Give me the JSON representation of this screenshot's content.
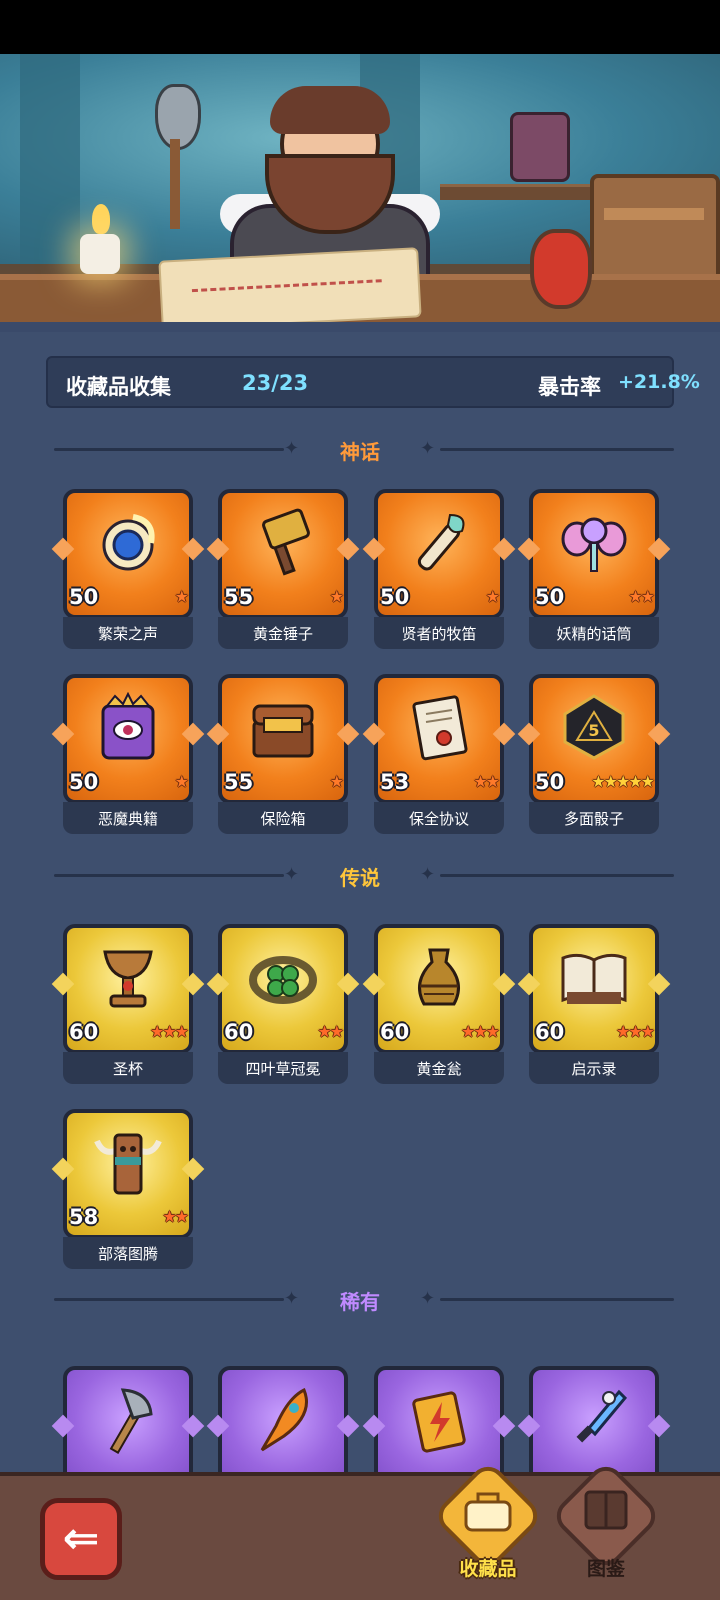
{
  "summary": {
    "label": "收藏品收集",
    "count": "23/23",
    "crit_label": "暴击率",
    "crit_value": "+21.8%"
  },
  "sections": {
    "mythic": "神话",
    "legend": "传说",
    "rare": "稀有"
  },
  "mythic_items": [
    {
      "name": "繁荣之声",
      "level": "50",
      "stars": "★",
      "icon": "blue-orb-icon"
    },
    {
      "name": "黄金锤子",
      "level": "55",
      "stars": "★",
      "icon": "golden-hammer-icon"
    },
    {
      "name": "贤者的牧笛",
      "level": "50",
      "stars": "★",
      "icon": "flute-icon"
    },
    {
      "name": "妖精的话筒",
      "level": "50",
      "stars": "★★",
      "icon": "fairy-microphone-icon"
    },
    {
      "name": "恶魔典籍",
      "level": "50",
      "stars": "★",
      "icon": "demon-book-icon"
    },
    {
      "name": "保险箱",
      "level": "55",
      "stars": "★",
      "icon": "treasure-chest-icon"
    },
    {
      "name": "保全协议",
      "level": "53",
      "stars": "★★",
      "icon": "contract-scroll-icon"
    },
    {
      "name": "多面骰子",
      "level": "50",
      "stars": "★★★★★",
      "icon": "dice-icon"
    }
  ],
  "legend_items": [
    {
      "name": "圣杯",
      "level": "60",
      "stars": "★★★",
      "icon": "chalice-icon"
    },
    {
      "name": "四叶草冠冕",
      "level": "60",
      "stars": "★★",
      "icon": "clover-crown-icon"
    },
    {
      "name": "黄金瓮",
      "level": "60",
      "stars": "★★★",
      "icon": "golden-urn-icon"
    },
    {
      "name": "启示录",
      "level": "60",
      "stars": "★★★",
      "icon": "open-book-icon"
    },
    {
      "name": "部落图腾",
      "level": "58",
      "stars": "★★",
      "icon": "tribal-totem-icon"
    }
  ],
  "rare_items": [
    {
      "icon": "axe-icon"
    },
    {
      "icon": "phoenix-feather-icon"
    },
    {
      "icon": "lightning-card-icon"
    },
    {
      "icon": "ice-dagger-icon"
    }
  ],
  "nav": {
    "collection_label": "收藏品",
    "codex_label": "图鉴"
  },
  "colors": {
    "mythic": "#f2801c",
    "legend": "#ecc83a",
    "rare": "#9a66e0",
    "panel": "#3e4f6e",
    "accent_cyan": "#7fe0ff"
  }
}
